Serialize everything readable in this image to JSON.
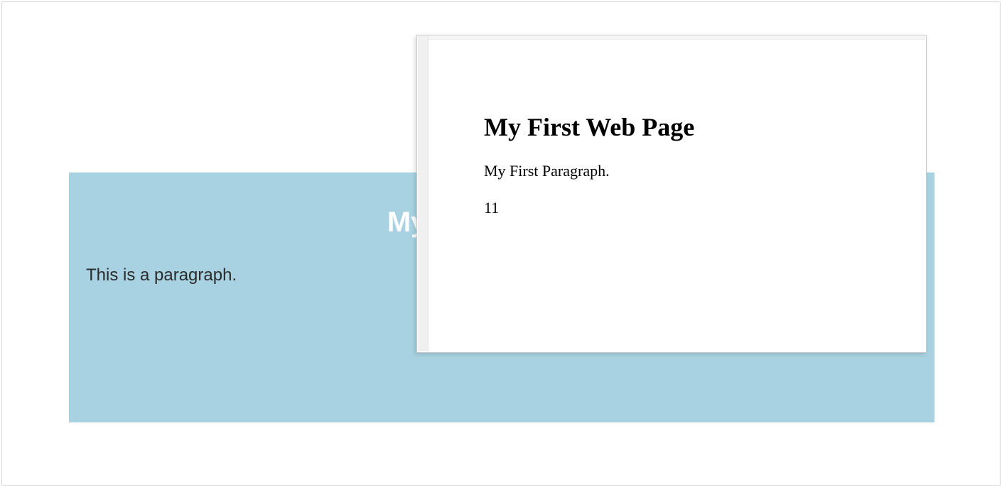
{
  "background_page": {
    "heading": "My First Heading",
    "heading_visible_prefix": "My Fi",
    "paragraph": "This is a paragraph."
  },
  "popup": {
    "heading": "My First Web Page",
    "paragraph": "My First Paragraph.",
    "output": "11"
  }
}
